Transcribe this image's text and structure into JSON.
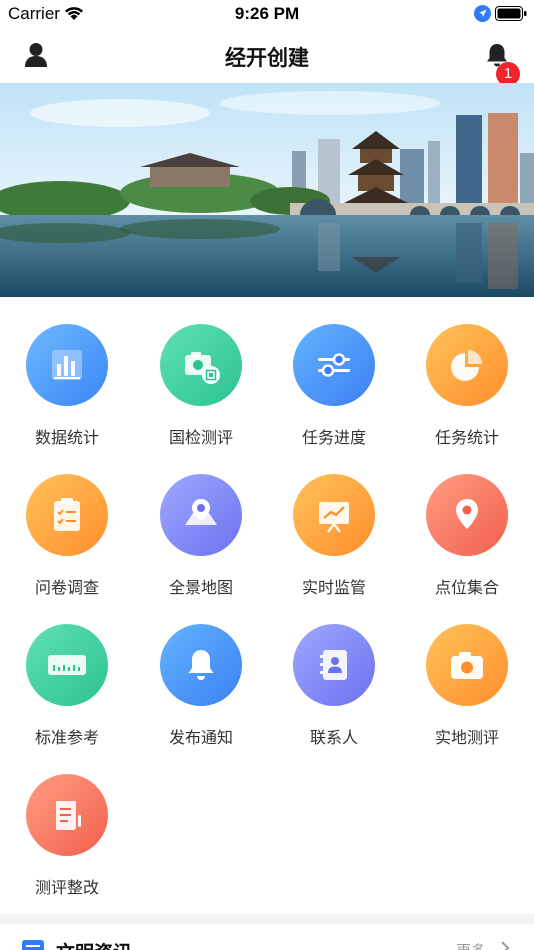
{
  "status_bar": {
    "carrier": "Carrier",
    "time": "9:26 PM"
  },
  "nav": {
    "title": "经开创建",
    "notification_count": "1"
  },
  "menu": [
    {
      "label": "数据统计",
      "icon": "bar-chart-icon",
      "color_from": "#6fb8ff",
      "color_to": "#3a86f5"
    },
    {
      "label": "国检测评",
      "icon": "camera-badge-icon",
      "color_from": "#5fe0b4",
      "color_to": "#2cc38f"
    },
    {
      "label": "任务进度",
      "icon": "sliders-icon",
      "color_from": "#62b4ff",
      "color_to": "#3d7ff2"
    },
    {
      "label": "任务统计",
      "icon": "pie-chart-icon",
      "color_from": "#ffc25a",
      "color_to": "#ff8e2c"
    },
    {
      "label": "问卷调查",
      "icon": "checklist-icon",
      "color_from": "#ffc25a",
      "color_to": "#ff8e2c"
    },
    {
      "label": "全景地图",
      "icon": "map-pin-icon",
      "color_from": "#9fa8ff",
      "color_to": "#6b72f0"
    },
    {
      "label": "实时监管",
      "icon": "presentation-chart-icon",
      "color_from": "#ffc25a",
      "color_to": "#ff8e2c"
    },
    {
      "label": "点位集合",
      "icon": "location-pin-icon",
      "color_from": "#ff9d82",
      "color_to": "#f25f4c"
    },
    {
      "label": "标准参考",
      "icon": "ruler-icon",
      "color_from": "#5fe0b4",
      "color_to": "#2cc38f"
    },
    {
      "label": "发布通知",
      "icon": "bell-icon",
      "color_from": "#62b4ff",
      "color_to": "#3d7ff2"
    },
    {
      "label": "联系人",
      "icon": "contact-book-icon",
      "color_from": "#9fa8ff",
      "color_to": "#6b72f0"
    },
    {
      "label": "实地测评",
      "icon": "camera-icon",
      "color_from": "#ffc25a",
      "color_to": "#ff8e2c"
    },
    {
      "label": "测评整改",
      "icon": "document-scroll-icon",
      "color_from": "#ff9d82",
      "color_to": "#f25f4c"
    }
  ],
  "news": {
    "title": "文明资讯",
    "more": "更多"
  }
}
